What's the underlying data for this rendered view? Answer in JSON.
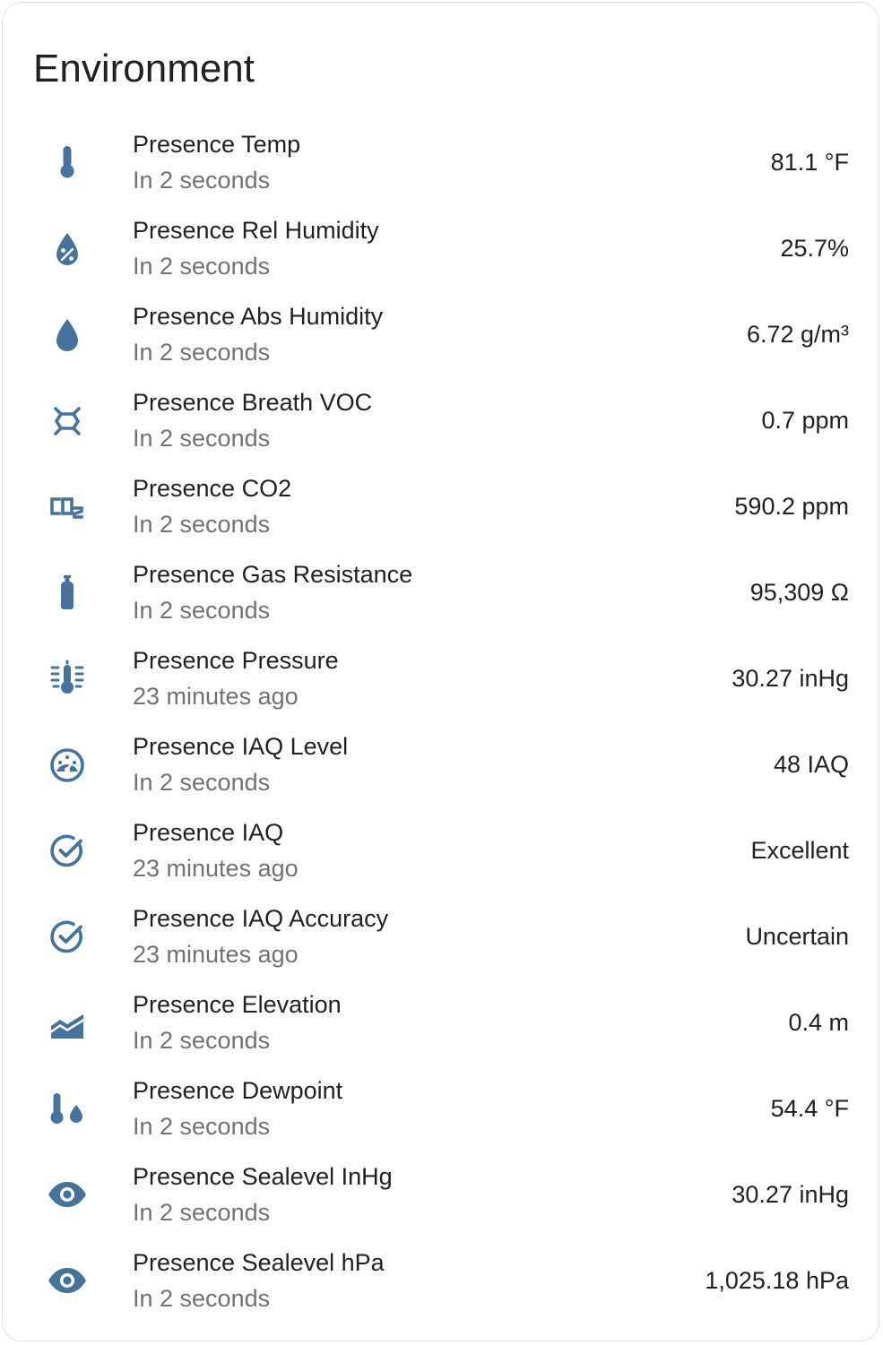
{
  "card": {
    "title": "Environment",
    "icon_color": "#44739e"
  },
  "entities": [
    {
      "icon": "thermometer-icon",
      "name": "Presence Temp",
      "secondary": "In 2 seconds",
      "state": "81.1 °F"
    },
    {
      "icon": "water-percent-icon",
      "name": "Presence Rel Humidity",
      "secondary": "In 2 seconds",
      "state": "25.7%"
    },
    {
      "icon": "water-drop-icon",
      "name": "Presence Abs Humidity",
      "secondary": "In 2 seconds",
      "state": "6.72 g/m³"
    },
    {
      "icon": "molecule-icon",
      "name": "Presence Breath VOC",
      "secondary": "In 2 seconds",
      "state": "0.7 ppm"
    },
    {
      "icon": "co2-icon",
      "name": "Presence CO2",
      "secondary": "In 2 seconds",
      "state": "590.2 ppm"
    },
    {
      "icon": "gas-cylinder-icon",
      "name": "Presence Gas Resistance",
      "secondary": "In 2 seconds",
      "state": "95,309 Ω"
    },
    {
      "icon": "thermometer-lines-icon",
      "name": "Presence Pressure",
      "secondary": "23 minutes ago",
      "state": "30.27 inHg"
    },
    {
      "icon": "gauge-icon",
      "name": "Presence IAQ Level",
      "secondary": "In 2 seconds",
      "state": "48 IAQ"
    },
    {
      "icon": "check-circle-outline-icon",
      "name": "Presence IAQ",
      "secondary": "23 minutes ago",
      "state": "Excellent"
    },
    {
      "icon": "check-circle-outline-icon",
      "name": "Presence IAQ Accuracy",
      "secondary": "23 minutes ago",
      "state": "Uncertain"
    },
    {
      "icon": "elevation-rise-icon",
      "name": "Presence Elevation",
      "secondary": "In 2 seconds",
      "state": "0.4 m"
    },
    {
      "icon": "thermometer-water-icon",
      "name": "Presence Dewpoint",
      "secondary": "In 2 seconds",
      "state": "54.4 °F"
    },
    {
      "icon": "eye-icon",
      "name": "Presence Sealevel InHg",
      "secondary": "In 2 seconds",
      "state": "30.27 inHg"
    },
    {
      "icon": "eye-icon",
      "name": "Presence Sealevel hPa",
      "secondary": "In 2 seconds",
      "state": "1,025.18 hPa"
    }
  ]
}
